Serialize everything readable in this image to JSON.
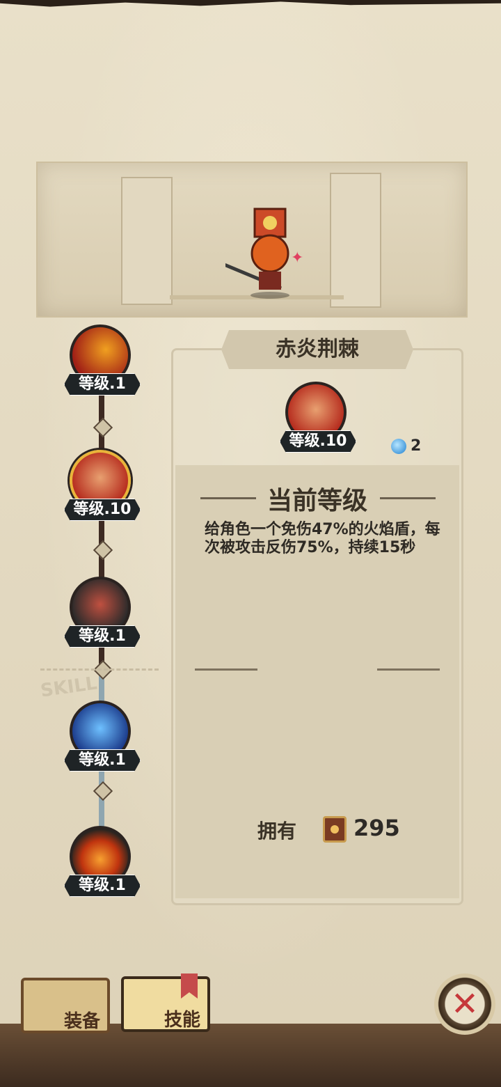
{
  "skill_title": "赤炎荆棘",
  "tree": [
    {
      "level": "等级.1",
      "active": false,
      "icon": "beam-skill-icon",
      "colors": [
        "#a12016",
        "#f0a020"
      ]
    },
    {
      "level": "等级.10",
      "active": true,
      "icon": "fire-shield-skill-icon",
      "colors": [
        "#b62c1e",
        "#e8a070"
      ]
    },
    {
      "level": "等级.1",
      "active": false,
      "icon": "axe-skill-icon",
      "colors": [
        "#8b1e1a",
        "#2a2a2a"
      ]
    },
    {
      "level": "等级.1",
      "active": false,
      "icon": "ice-skill-icon",
      "colors": [
        "#1b3a8a",
        "#6ec0ff"
      ]
    },
    {
      "level": "等级.1",
      "active": false,
      "icon": "flame-skill-icon",
      "colors": [
        "#c0340f",
        "#f7a030"
      ]
    }
  ],
  "detail": {
    "level": "等级.10",
    "mana_cost": "2",
    "section_title": "当前等级",
    "description": "给角色一个免伤47%的火焰盾，每次被攻击反伤75%，持续15秒",
    "own_label": "拥有",
    "own_count": "295"
  },
  "watermark": "SKILL",
  "tabs": {
    "equipment": "装备",
    "skills": "技能"
  },
  "close_label": "✕"
}
